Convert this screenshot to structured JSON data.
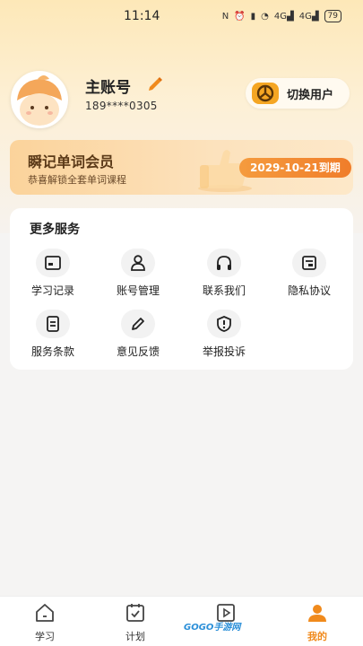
{
  "status_bar": {
    "time": "11:14",
    "battery": "79",
    "signal_1": "4G",
    "signal_2": "4G"
  },
  "profile": {
    "username": "主账号",
    "phone": "189****0305",
    "switch_label": "切换用户"
  },
  "vip": {
    "title": "瞬记单词会员",
    "subtitle": "恭喜解锁全套单词课程",
    "expire": "2029-10-21到期"
  },
  "services": {
    "title": "更多服务",
    "items": [
      {
        "label": "学习记录",
        "icon": "id-card-icon"
      },
      {
        "label": "账号管理",
        "icon": "user-icon"
      },
      {
        "label": "联系我们",
        "icon": "headphones-icon"
      },
      {
        "label": "隐私协议",
        "icon": "document-icon"
      },
      {
        "label": "服务条款",
        "icon": "terms-icon"
      },
      {
        "label": "意见反馈",
        "icon": "pencil-icon"
      },
      {
        "label": "举报投诉",
        "icon": "shield-alert-icon"
      }
    ]
  },
  "nav": {
    "items": [
      {
        "label": "学习",
        "icon": "home-icon"
      },
      {
        "label": "计划",
        "icon": "checklist-icon"
      },
      {
        "label": "",
        "icon": "play-icon"
      },
      {
        "label": "我的",
        "icon": "profile-icon"
      }
    ],
    "active": "我的"
  },
  "watermark": "GOGO手游网",
  "colors": {
    "accent": "#f08a1c",
    "vip_text": "#5b3a18"
  }
}
